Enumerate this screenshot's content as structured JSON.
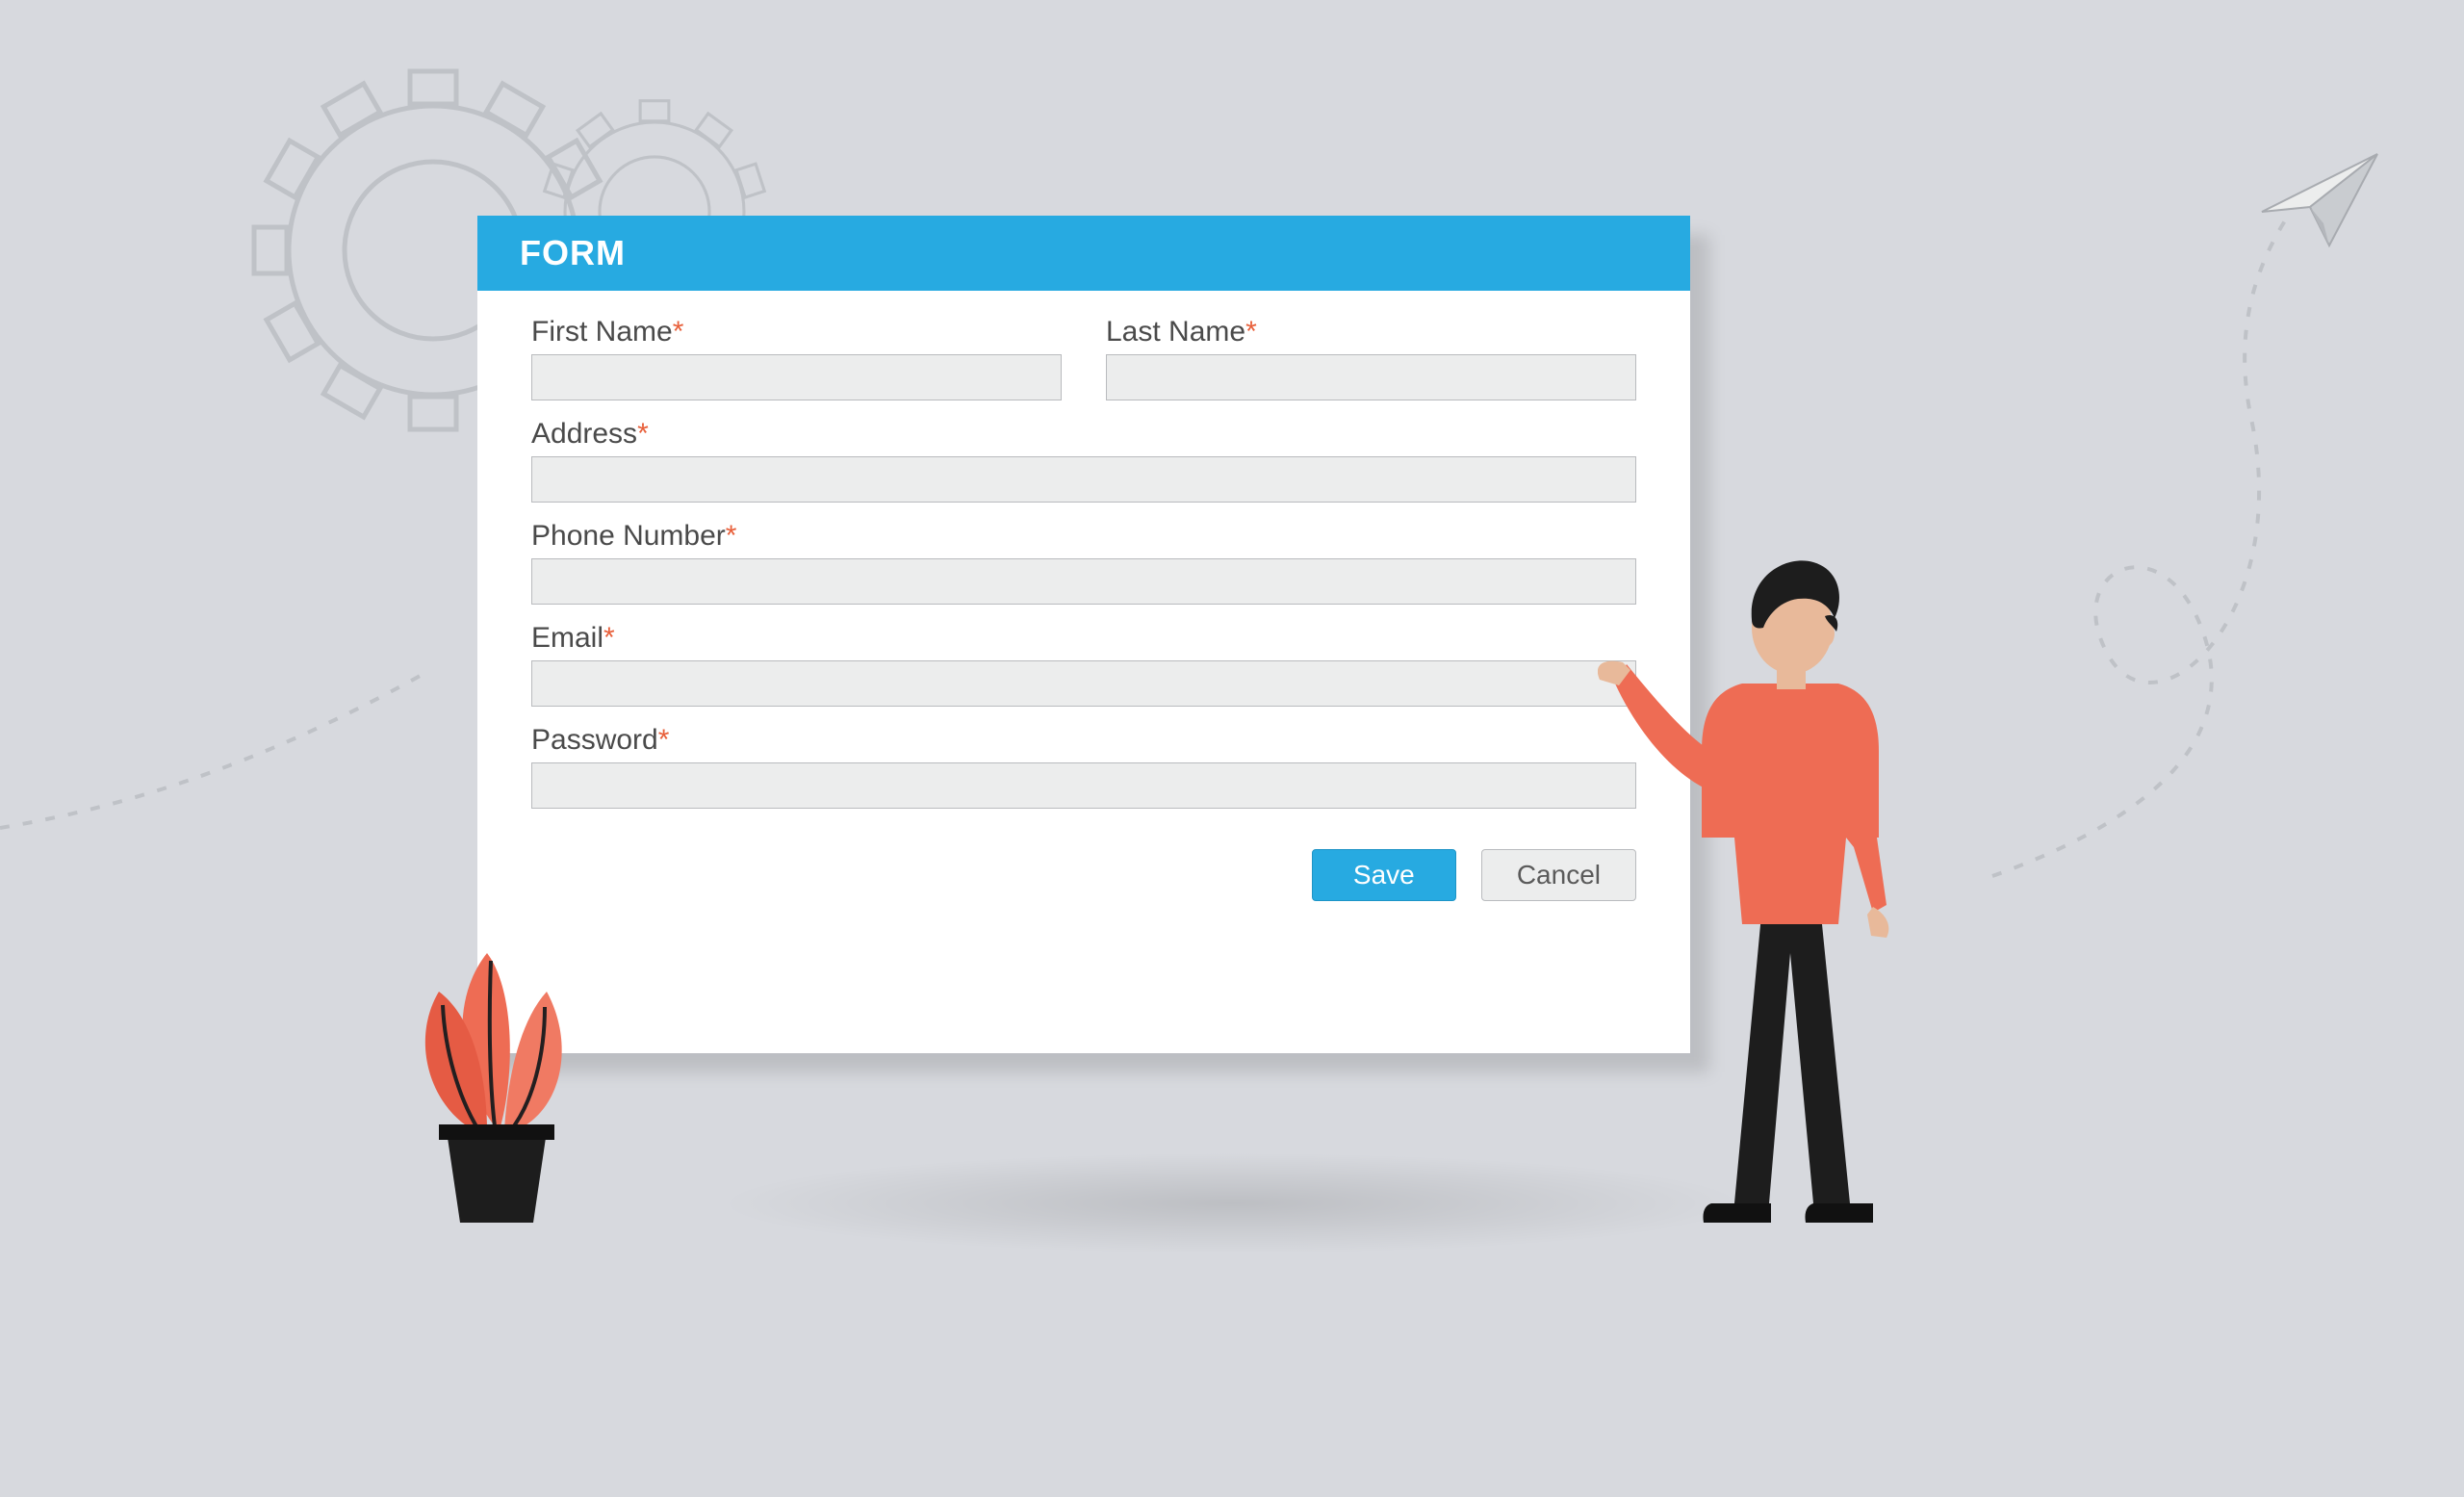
{
  "header": {
    "title": "FORM"
  },
  "fields": {
    "first_name": {
      "label": "First Name",
      "required_mark": "*",
      "value": ""
    },
    "last_name": {
      "label": "Last Name",
      "required_mark": "*",
      "value": ""
    },
    "address": {
      "label": "Address",
      "required_mark": "*",
      "value": ""
    },
    "phone": {
      "label": "Phone Number",
      "required_mark": "*",
      "value": ""
    },
    "email": {
      "label": "Email",
      "required_mark": "*",
      "value": ""
    },
    "password": {
      "label": "Password",
      "required_mark": "*",
      "value": ""
    }
  },
  "actions": {
    "save_label": "Save",
    "cancel_label": "Cancel"
  },
  "colors": {
    "background": "#d7d9de",
    "accent": "#27aae1",
    "input_bg": "#eceded",
    "input_border": "#b9bbbe",
    "required": "#e8603b"
  }
}
